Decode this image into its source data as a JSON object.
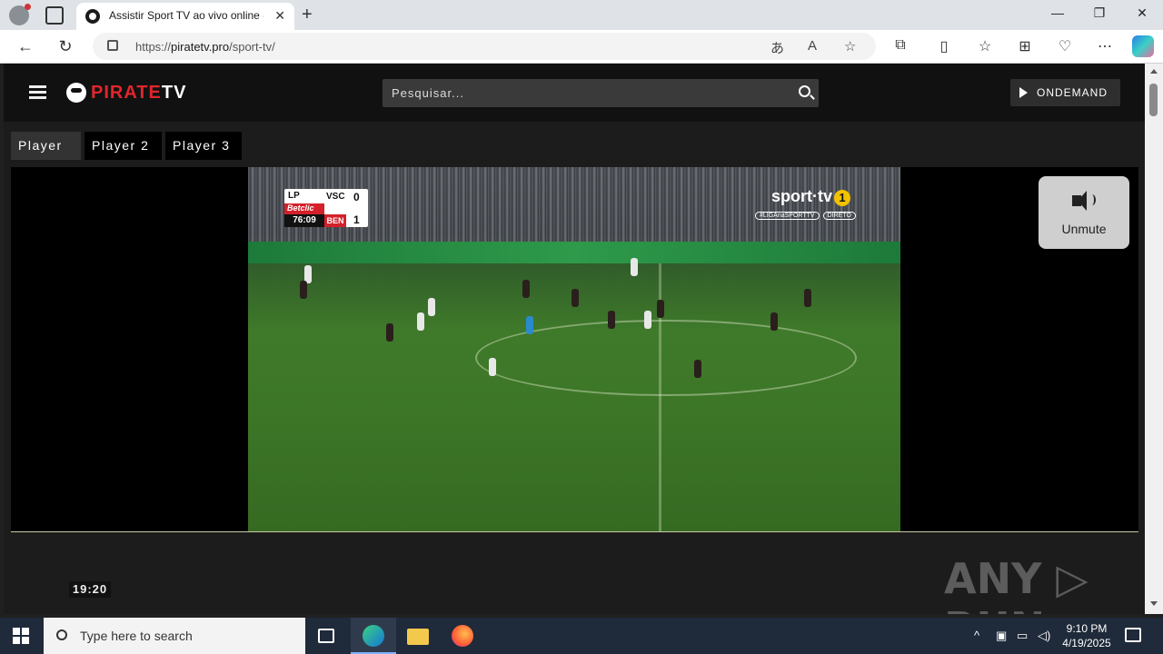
{
  "browser": {
    "tab_title": "Assistir Sport TV ao vivo online - ",
    "url_prefix": "https://",
    "url_domain": "piratetv.pro",
    "url_path": "/sport-tv/",
    "window_controls": {
      "minimize": "—",
      "restore": "❐",
      "close": "✕"
    }
  },
  "site": {
    "logo_red": "PIRATE",
    "logo_white": "TV",
    "search_placeholder": "Pesquisar...",
    "ondemand_label": "ONDEMAND",
    "player_tabs": [
      "Player 1",
      "Player 2",
      "Player 3"
    ],
    "active_player_tab": 0,
    "unmute_label": "Unmute",
    "clock": "19:20",
    "watermark": "ANY ▷ RUN"
  },
  "video_overlay": {
    "league": "LP",
    "sponsor": "Betclic",
    "match_time": "76:09",
    "home_team": "VSC",
    "home_score": "0",
    "away_team": "BEN",
    "away_score": "1",
    "channel_name": "sport·tv",
    "channel_number": "1",
    "hashtag": "#LIGAnaSPORTTV",
    "live_tag": "DIRETO"
  },
  "taskbar": {
    "search_label": "Type here to search",
    "time": "9:10 PM",
    "date": "4/19/2025"
  },
  "colors": {
    "accent_red": "#e0262b",
    "page_bg": "#1c1c1c",
    "header_bg": "#111111",
    "taskbar_bg": "#1f2a3a"
  }
}
